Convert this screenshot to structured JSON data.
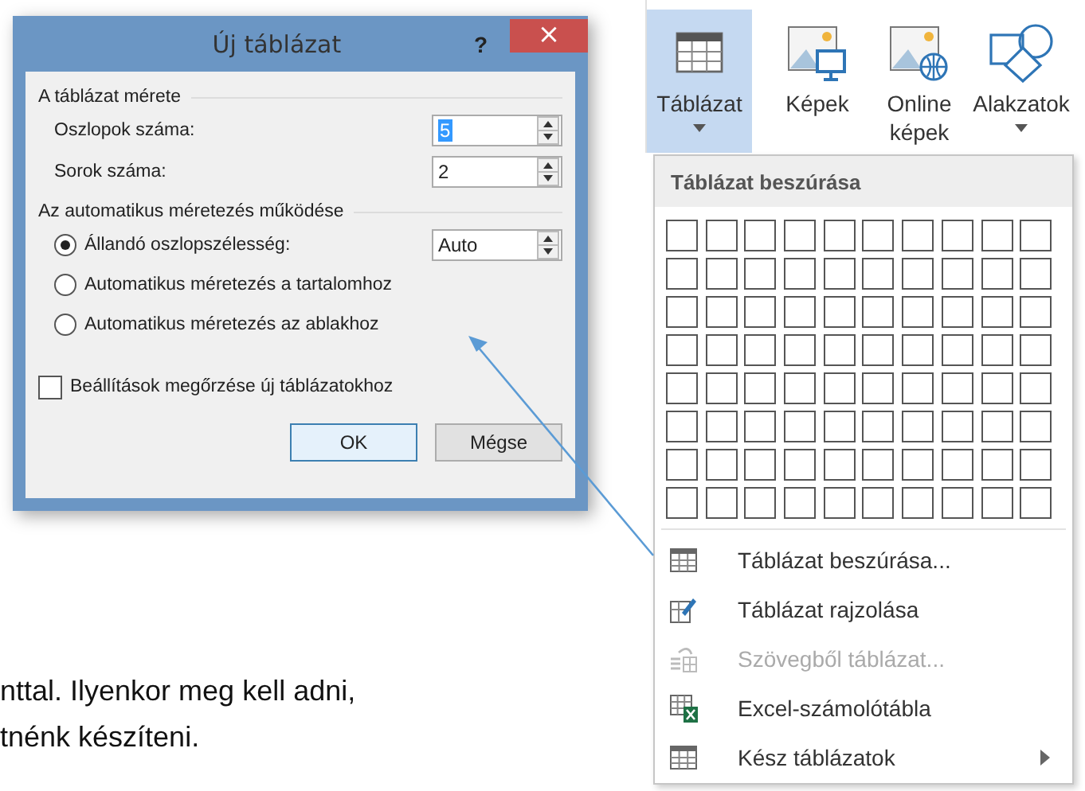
{
  "document": {
    "lines": [
      "nttal. Ilyenkor meg kell adni,",
      "tnénk készíteni."
    ]
  },
  "ribbon": {
    "buttons": [
      {
        "label": "Táblázat",
        "kind": "table",
        "selected": true,
        "dropdown": true
      },
      {
        "label": "Képek",
        "kind": "pictures",
        "selected": false,
        "dropdown": false
      },
      {
        "label": "Online képek",
        "kind": "online",
        "selected": false,
        "dropdown": false
      },
      {
        "label": "Alakzatok",
        "kind": "shapes",
        "selected": false,
        "dropdown": true
      }
    ]
  },
  "menu": {
    "title": "Táblázat beszúrása",
    "items": [
      {
        "label": "Táblázat beszúrása...",
        "kind": "table",
        "disabled": false,
        "submenu": false
      },
      {
        "label": "Táblázat rajzolása",
        "kind": "draw",
        "disabled": false,
        "submenu": false
      },
      {
        "label": "Szövegből táblázat...",
        "kind": "convert",
        "disabled": true,
        "submenu": false
      },
      {
        "label": "Excel-számolótábla",
        "kind": "excel",
        "disabled": false,
        "submenu": false
      },
      {
        "label": "Kész táblázatok",
        "kind": "table",
        "disabled": false,
        "submenu": true
      }
    ]
  },
  "dialog": {
    "title": "Új táblázat",
    "help": "?",
    "close": "×",
    "size_group": {
      "heading": "A táblázat mérete",
      "fields": [
        {
          "label": "Oszlopok száma:",
          "value": "5",
          "selected": true
        },
        {
          "label": "Sorok száma:",
          "value": "2",
          "selected": false
        }
      ]
    },
    "autofit_group": {
      "heading": "Az automatikus méretezés működése",
      "options": [
        {
          "label": "Állandó oszlopszélesség:",
          "selected": true,
          "value": "Auto"
        },
        {
          "label": "Automatikus méretezés a tartalomhoz",
          "selected": false
        },
        {
          "label": "Automatikus méretezés az ablakhoz",
          "selected": false
        }
      ]
    },
    "remember": {
      "label": "Beállítások megőrzése új táblázatokhoz",
      "checked": false
    },
    "buttons": [
      {
        "label": "OK",
        "default": true
      },
      {
        "label": "Mégse",
        "default": false
      }
    ]
  }
}
